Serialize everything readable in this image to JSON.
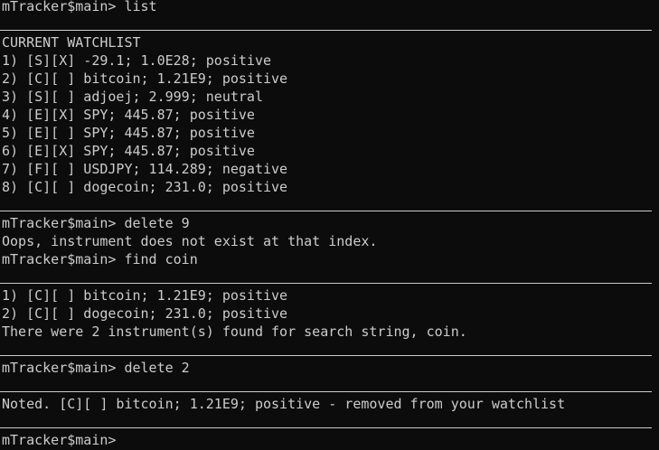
{
  "prompt": "mTracker$main> ",
  "colors": {
    "background": "#0c0c0c",
    "foreground": "#cccccc",
    "separator": "#cccccc"
  },
  "blocks": {
    "cmd_list": "mTracker$main> list",
    "watchlist_header": "CURRENT WATCHLIST",
    "watchlist": [
      "1) [S][X] -29.1; 1.0E28; positive",
      "2) [C][ ] bitcoin; 1.21E9; positive",
      "3) [S][ ] adjoej; 2.999; neutral",
      "4) [E][X] SPY; 445.87; positive",
      "5) [E][ ] SPY; 445.87; positive",
      "6) [E][X] SPY; 445.87; positive",
      "7) [F][ ] USDJPY; 114.289; negative",
      "8) [C][ ] dogecoin; 231.0; positive"
    ],
    "cmd_delete9": "mTracker$main> delete 9",
    "error_delete9": "Oops, instrument does not exist at that index.",
    "cmd_find": "mTracker$main> find coin",
    "find_results": [
      "1) [C][ ] bitcoin; 1.21E9; positive",
      "2) [C][ ] dogecoin; 231.0; positive"
    ],
    "find_summary": "There were 2 instrument(s) found for search string, coin.",
    "cmd_delete2": "mTracker$main> delete 2",
    "delete_confirm": "Noted. [C][ ] bitcoin; 1.21E9; positive - removed from your watchlist",
    "current_prompt": "mTracker$main>"
  }
}
